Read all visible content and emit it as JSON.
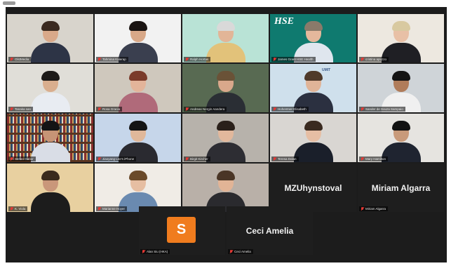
{
  "participants": [
    {
      "label": "OlstMedia",
      "bg": "#d8d4cc",
      "hair": "#3b2a20",
      "shirt": "#2d3446",
      "skin": "#d9a98a"
    },
    {
      "label": "Tahmina Kalerap",
      "bg": "#f2f2f2",
      "hair": "#1a1412",
      "shirt": "#3a3f4f",
      "skin": "#d8a888"
    },
    {
      "label": "Ralph Hortas",
      "bg": "#b9e3d6",
      "hair": "#d9d9d9",
      "shirt": "#e2c27a",
      "skin": "#e2b597"
    },
    {
      "label": "James Grant HSE Health",
      "bg": "#0f7a6f",
      "hair": "#8a7a6a",
      "shirt": "#dfe6ee",
      "skin": "#e4b89c",
      "logo": "HSE"
    },
    {
      "label": "cristina apuzzo",
      "bg": "#ede8e0",
      "hair": "#d8c9a0",
      "shirt": "#1f1f24",
      "skin": "#e8c0a6"
    },
    {
      "label": "Tanaka san",
      "bg": "#e0ded8",
      "hair": "#1d1a18",
      "shirt": "#e8ecf2",
      "skin": "#d9ae8e"
    },
    {
      "label": "Rosa Gracia",
      "bg": "#cfc8bd",
      "hair": "#7a3b2a",
      "shirt": "#b06a7a",
      "skin": "#e3b49a"
    },
    {
      "label": "Andreas Nergin Aandera",
      "bg": "#586a52",
      "hair": "#6a5237",
      "shirt": "#2a2e34",
      "skin": "#d9a88b"
    },
    {
      "label": "Hohentner Elisabeth",
      "bg": "#cfe0ec",
      "hair": "#4f3a2a",
      "shirt": "#2b3040",
      "skin": "#e0b498",
      "logo": "UMIT"
    },
    {
      "label": "Sander de Souza Sampaio",
      "bg": "#cfd4d8",
      "hair": "#141414",
      "shirt": "#f0f0f0",
      "skin": "#b07c5a"
    },
    {
      "label": "Stefan Gabor",
      "bg": "#6a4030",
      "hair": "#141414",
      "shirt": "#d9dde6",
      "skin": "#c79476",
      "shelf": true
    },
    {
      "label": "Jiaoyang Lee's iPhone",
      "bg": "#c6d6ea",
      "hair": "#141414",
      "shirt": "#2a2a30",
      "skin": "#e0b89a"
    },
    {
      "label": "Birgit Kircher",
      "bg": "#b7b2ab",
      "hair": "#2a201a",
      "shirt": "#2d2d33",
      "skin": "#e2b89c"
    },
    {
      "label": "Teresa Dolan",
      "bg": "#d9d6d2",
      "hair": "#3a2a20",
      "shirt": "#1a1f2a",
      "skin": "#e6bea4"
    },
    {
      "label": "Mary Hamilton",
      "bg": "#e6e4e0",
      "hair": "#121212",
      "shirt": "#1f2430",
      "skin": "#c89a7a"
    },
    {
      "label": "K. Viola",
      "bg": "#e8d0a0",
      "hair": "#3a2a1c",
      "shirt": "#1c1c1c",
      "skin": "#c9977a"
    },
    {
      "label": "Marianne Hoyer",
      "bg": "#f0ece6",
      "hair": "#6a4a2a",
      "shirt": "#6a8ab0",
      "skin": "#e6bea2"
    },
    {
      "label": "Jae Kanongi",
      "bg": "#b9b0a8",
      "hair": "#4a3526",
      "shirt": "#2a2a2e",
      "skin": "#e2b496"
    },
    {
      "label": "MZUhynstoval",
      "bigname": "MZUhynstoval"
    },
    {
      "label": "Miriam Algarra",
      "bigname": "Miriam Algarra"
    }
  ],
  "bottom": [
    {
      "label": "Alan Siu (HKA)",
      "avatar_letter": "S",
      "avatar_color": "#f07c1e"
    },
    {
      "label": "Ceci Amelia",
      "bigname": "Ceci Amelia"
    }
  ]
}
